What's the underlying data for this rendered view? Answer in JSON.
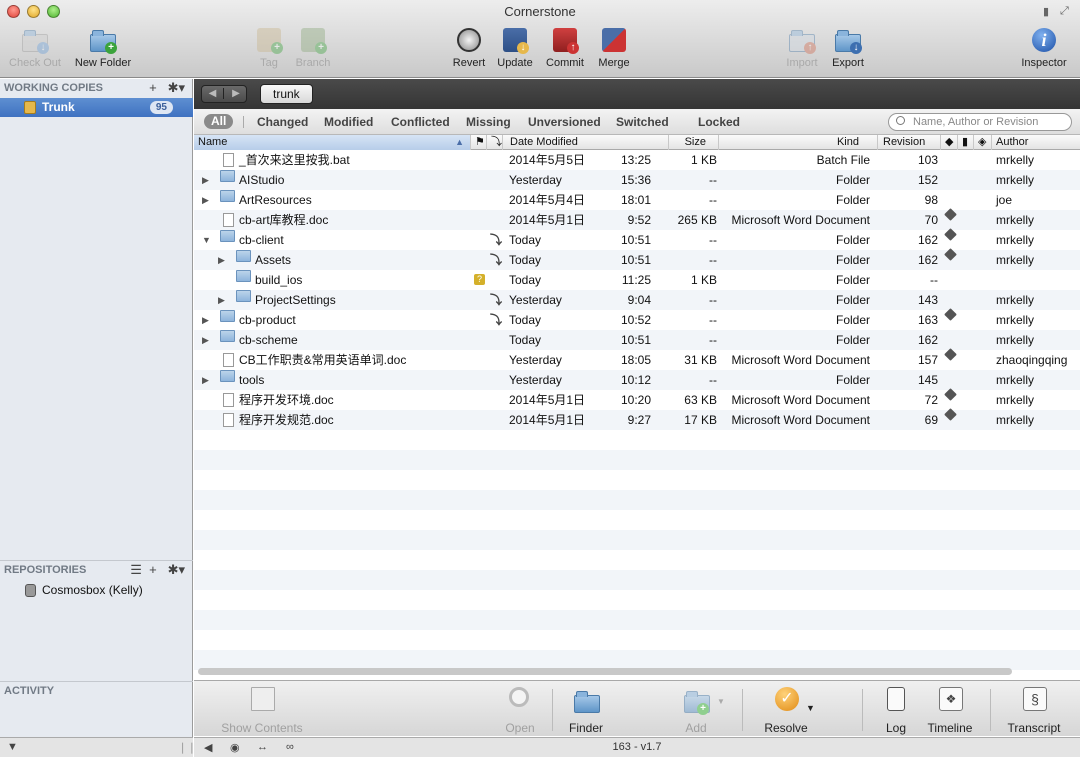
{
  "window": {
    "title": "Cornerstone"
  },
  "toolbar": {
    "check_out": "Check Out",
    "new_folder": "New Folder",
    "tag": "Tag",
    "branch": "Branch",
    "revert": "Revert",
    "update": "Update",
    "commit": "Commit",
    "merge": "Merge",
    "import": "Import",
    "export": "Export",
    "inspector": "Inspector"
  },
  "sidebar": {
    "working_copies": "WORKING COPIES",
    "trunk_label": "Trunk",
    "trunk_count": "95",
    "repositories": "REPOSITORIES",
    "repo_name": "Cosmosbox (Kelly)",
    "activity": "ACTIVITY",
    "add": "+",
    "gear": "✱▾"
  },
  "path": {
    "back": "◀",
    "forward": "▶",
    "crumb": "trunk"
  },
  "filters": [
    "All",
    "Changed",
    "Modified",
    "Conflicted",
    "Missing",
    "Unversioned",
    "Switched",
    "Locked"
  ],
  "search": {
    "placeholder": "Name, Author or Revision"
  },
  "columns": {
    "name": "Name",
    "date": "Date Modified",
    "size": "Size",
    "kind": "Kind",
    "revision": "Revision",
    "author": "Author"
  },
  "files": [
    {
      "name": "_首次来这里按我.bat",
      "date": "2014年5月5日",
      "time": "13:25",
      "size": "1 KB",
      "kind": "Batch File",
      "rev": "103",
      "author": "mrkelly",
      "type": "file",
      "depth": 0,
      "tri": "",
      "arrow": false,
      "q": false,
      "tag": false
    },
    {
      "name": "AIStudio",
      "date": "Yesterday",
      "time": "15:36",
      "size": "--",
      "kind": "Folder",
      "rev": "152",
      "author": "mrkelly",
      "type": "dir",
      "depth": 0,
      "tri": "▶",
      "arrow": false,
      "q": false,
      "tag": false
    },
    {
      "name": "ArtResources",
      "date": "2014年5月4日",
      "time": "18:01",
      "size": "--",
      "kind": "Folder",
      "rev": "98",
      "author": "joe",
      "type": "dir",
      "depth": 0,
      "tri": "▶",
      "arrow": false,
      "q": false,
      "tag": false
    },
    {
      "name": "cb-art库教程.doc",
      "date": "2014年5月1日",
      "time": "9:52",
      "size": "265 KB",
      "kind": "Microsoft Word Document",
      "rev": "70",
      "author": "mrkelly",
      "type": "file",
      "depth": 0,
      "tri": "",
      "arrow": false,
      "q": false,
      "tag": true
    },
    {
      "name": "cb-client",
      "date": "Today",
      "time": "10:51",
      "size": "--",
      "kind": "Folder",
      "rev": "162",
      "author": "mrkelly",
      "type": "dir",
      "depth": 0,
      "tri": "▼",
      "arrow": true,
      "q": false,
      "tag": true
    },
    {
      "name": "Assets",
      "date": "Today",
      "time": "10:51",
      "size": "--",
      "kind": "Folder",
      "rev": "162",
      "author": "mrkelly",
      "type": "dir",
      "depth": 1,
      "tri": "▶",
      "arrow": true,
      "q": false,
      "tag": true
    },
    {
      "name": "build_ios",
      "date": "Today",
      "time": "11:25",
      "size": "1 KB",
      "kind": "Folder",
      "rev": "--",
      "author": "",
      "type": "dir",
      "depth": 1,
      "tri": "",
      "arrow": false,
      "q": true,
      "tag": false
    },
    {
      "name": "ProjectSettings",
      "date": "Yesterday",
      "time": "9:04",
      "size": "--",
      "kind": "Folder",
      "rev": "143",
      "author": "mrkelly",
      "type": "dir",
      "depth": 1,
      "tri": "▶",
      "arrow": true,
      "q": false,
      "tag": false
    },
    {
      "name": "cb-product",
      "date": "Today",
      "time": "10:52",
      "size": "--",
      "kind": "Folder",
      "rev": "163",
      "author": "mrkelly",
      "type": "dir",
      "depth": 0,
      "tri": "▶",
      "arrow": true,
      "q": false,
      "tag": true
    },
    {
      "name": "cb-scheme",
      "date": "Today",
      "time": "10:51",
      "size": "--",
      "kind": "Folder",
      "rev": "162",
      "author": "mrkelly",
      "type": "dir",
      "depth": 0,
      "tri": "▶",
      "arrow": false,
      "q": false,
      "tag": false
    },
    {
      "name": "CB工作职责&常用英语单词.doc",
      "date": "Yesterday",
      "time": "18:05",
      "size": "31 KB",
      "kind": "Microsoft Word Document",
      "rev": "157",
      "author": "zhaoqingqing",
      "type": "file",
      "depth": 0,
      "tri": "",
      "arrow": false,
      "q": false,
      "tag": true
    },
    {
      "name": "tools",
      "date": "Yesterday",
      "time": "10:12",
      "size": "--",
      "kind": "Folder",
      "rev": "145",
      "author": "mrkelly",
      "type": "dir",
      "depth": 0,
      "tri": "▶",
      "arrow": false,
      "q": false,
      "tag": false
    },
    {
      "name": "程序开发环境.doc",
      "date": "2014年5月1日",
      "time": "10:20",
      "size": "63 KB",
      "kind": "Microsoft Word Document",
      "rev": "72",
      "author": "mrkelly",
      "type": "file",
      "depth": 0,
      "tri": "",
      "arrow": false,
      "q": false,
      "tag": true
    },
    {
      "name": "程序开发规范.doc",
      "date": "2014年5月1日",
      "time": "9:27",
      "size": "17 KB",
      "kind": "Microsoft Word Document",
      "rev": "69",
      "author": "mrkelly",
      "type": "file",
      "depth": 0,
      "tri": "",
      "arrow": false,
      "q": false,
      "tag": true
    }
  ],
  "bottombar": {
    "show_contents": "Show Contents",
    "open": "Open",
    "finder": "Finder",
    "add": "Add",
    "resolve": "Resolve",
    "log": "Log",
    "timeline": "Timeline",
    "transcript": "Transcript"
  },
  "status": {
    "text": "163 - v1.7"
  },
  "colors": {
    "selection": "#3f72c1",
    "path_bar": "#3c3c3c",
    "folder": "#8eb4dc"
  }
}
